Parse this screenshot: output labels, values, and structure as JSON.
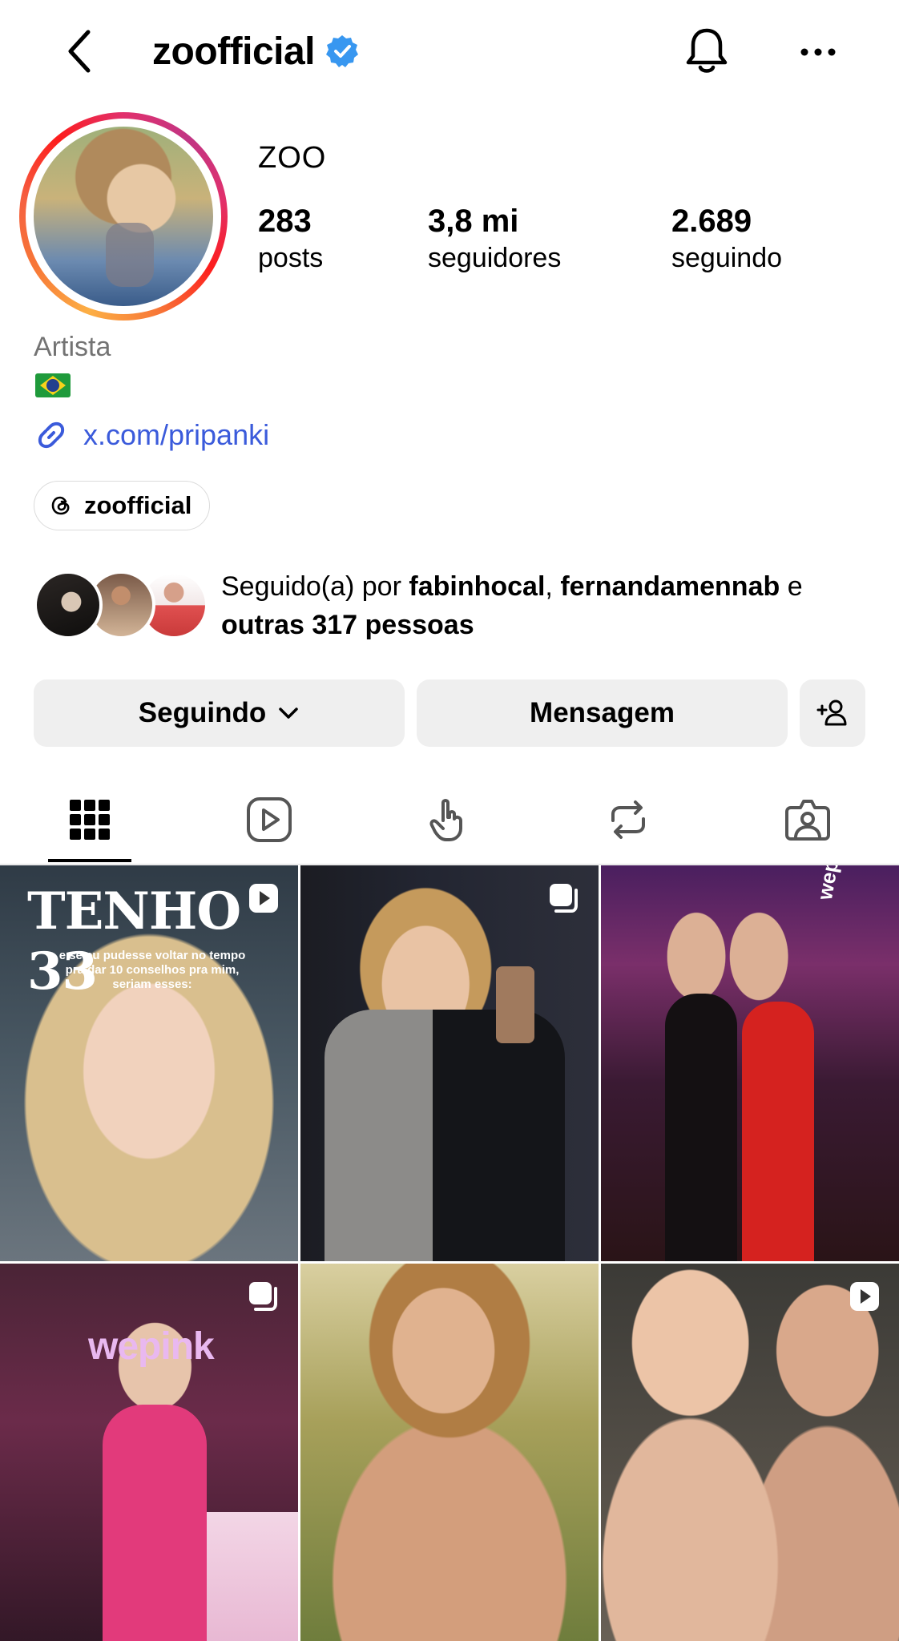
{
  "header": {
    "username": "zoofficial",
    "verified": true,
    "icons": [
      "back-arrow-icon",
      "verified-badge-icon",
      "bell-icon",
      "more-options-icon"
    ]
  },
  "profile": {
    "full_name": "ZOO",
    "stats": {
      "posts_value": "283",
      "posts_label": "posts",
      "followers_value": "3,8 mi",
      "followers_label": "seguidores",
      "following_value": "2.689",
      "following_label": "seguindo"
    },
    "category": "Artista",
    "flag": "brazil-flag",
    "link": "x.com/pripanki",
    "threads_handle": "zoofficial"
  },
  "followed_by": {
    "prefix": "Seguido(a) por ",
    "user_1": "fabinhocal",
    "separator": ", ",
    "user_2": "fernandamennab",
    "conjunction": " e",
    "others": "outras 317 pessoas"
  },
  "actions": {
    "following_label": "Seguindo",
    "message_label": "Mensagem",
    "suggest_icon": "add-person-icon"
  },
  "tabs": [
    {
      "name": "posts-grid",
      "icon": "grid-icon",
      "active": true
    },
    {
      "name": "reels",
      "icon": "reels-icon",
      "active": false
    },
    {
      "name": "taps",
      "icon": "tap-hand-icon",
      "active": false
    },
    {
      "name": "reposts",
      "icon": "repost-icon",
      "active": false
    },
    {
      "name": "tagged",
      "icon": "tagged-person-icon",
      "active": false
    }
  ],
  "posts": [
    {
      "type": "reel",
      "overlay_text": "TENHO 33",
      "caption": "e se eu pudesse voltar no tempo pra dar 10 conselhos pra mim, seriam esses:"
    },
    {
      "type": "carousel"
    },
    {
      "type": "photo",
      "sign_text": "wepink"
    },
    {
      "type": "carousel",
      "sign_text": "wepink"
    },
    {
      "type": "photo"
    },
    {
      "type": "reel"
    }
  ],
  "colors": {
    "link": "#3b5bdb",
    "verified": "#3897f0",
    "button_bg": "#efefef",
    "muted_text": "#737373"
  }
}
